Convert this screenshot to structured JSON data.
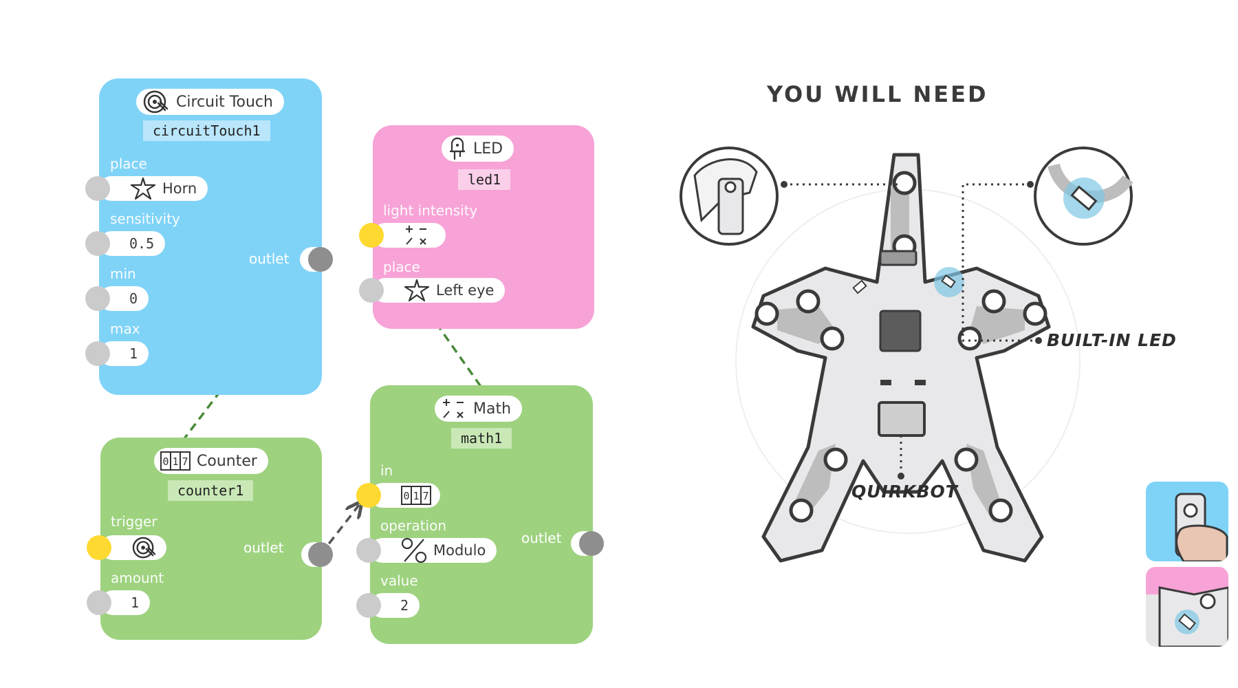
{
  "nodes": {
    "circuit_touch": {
      "title": "Circuit Touch",
      "instance": "circuitTouch1",
      "icon": "circuit-touch-icon",
      "params": {
        "place": {
          "label": "place",
          "value": "Horn",
          "icon": "quirkbot-icon"
        },
        "sensitivity": {
          "label": "sensitivity",
          "value": "0.5"
        },
        "min": {
          "label": "min",
          "value": "0"
        },
        "max": {
          "label": "max",
          "value": "1"
        }
      },
      "outlet": "outlet",
      "color": "#7fd3f7"
    },
    "led": {
      "title": "LED",
      "instance": "led1",
      "icon": "led-icon",
      "params": {
        "light_intensity": {
          "label": "light intensity",
          "icon": "math-icon"
        },
        "place": {
          "label": "place",
          "value": "Left eye",
          "icon": "quirkbot-icon"
        }
      },
      "color": "#f7a3d7"
    },
    "counter": {
      "title": "Counter",
      "instance": "counter1",
      "icon": "counter-icon",
      "params": {
        "trigger": {
          "label": "trigger",
          "icon": "circuit-touch-icon"
        },
        "amount": {
          "label": "amount",
          "value": "1"
        }
      },
      "outlet": "outlet",
      "color": "#9ed27f"
    },
    "math": {
      "title": "Math",
      "instance": "math1",
      "icon": "math-icon",
      "params": {
        "in": {
          "label": "in",
          "icon": "counter-icon"
        },
        "operation": {
          "label": "operation",
          "value": "Modulo",
          "icon": "percent-icon"
        },
        "value": {
          "label": "value",
          "value": "2"
        }
      },
      "outlet": "outlet",
      "color": "#9ed27f"
    }
  },
  "you_will_need": {
    "title": "YOU WILL NEED",
    "built_in_led": "BUILT-IN LED",
    "quirkbot": "QUIRKBOT"
  },
  "colors": {
    "port_active": "#fdd931",
    "port_inactive": "#cbcbcb",
    "port_outlet": "#8e8e8e"
  }
}
